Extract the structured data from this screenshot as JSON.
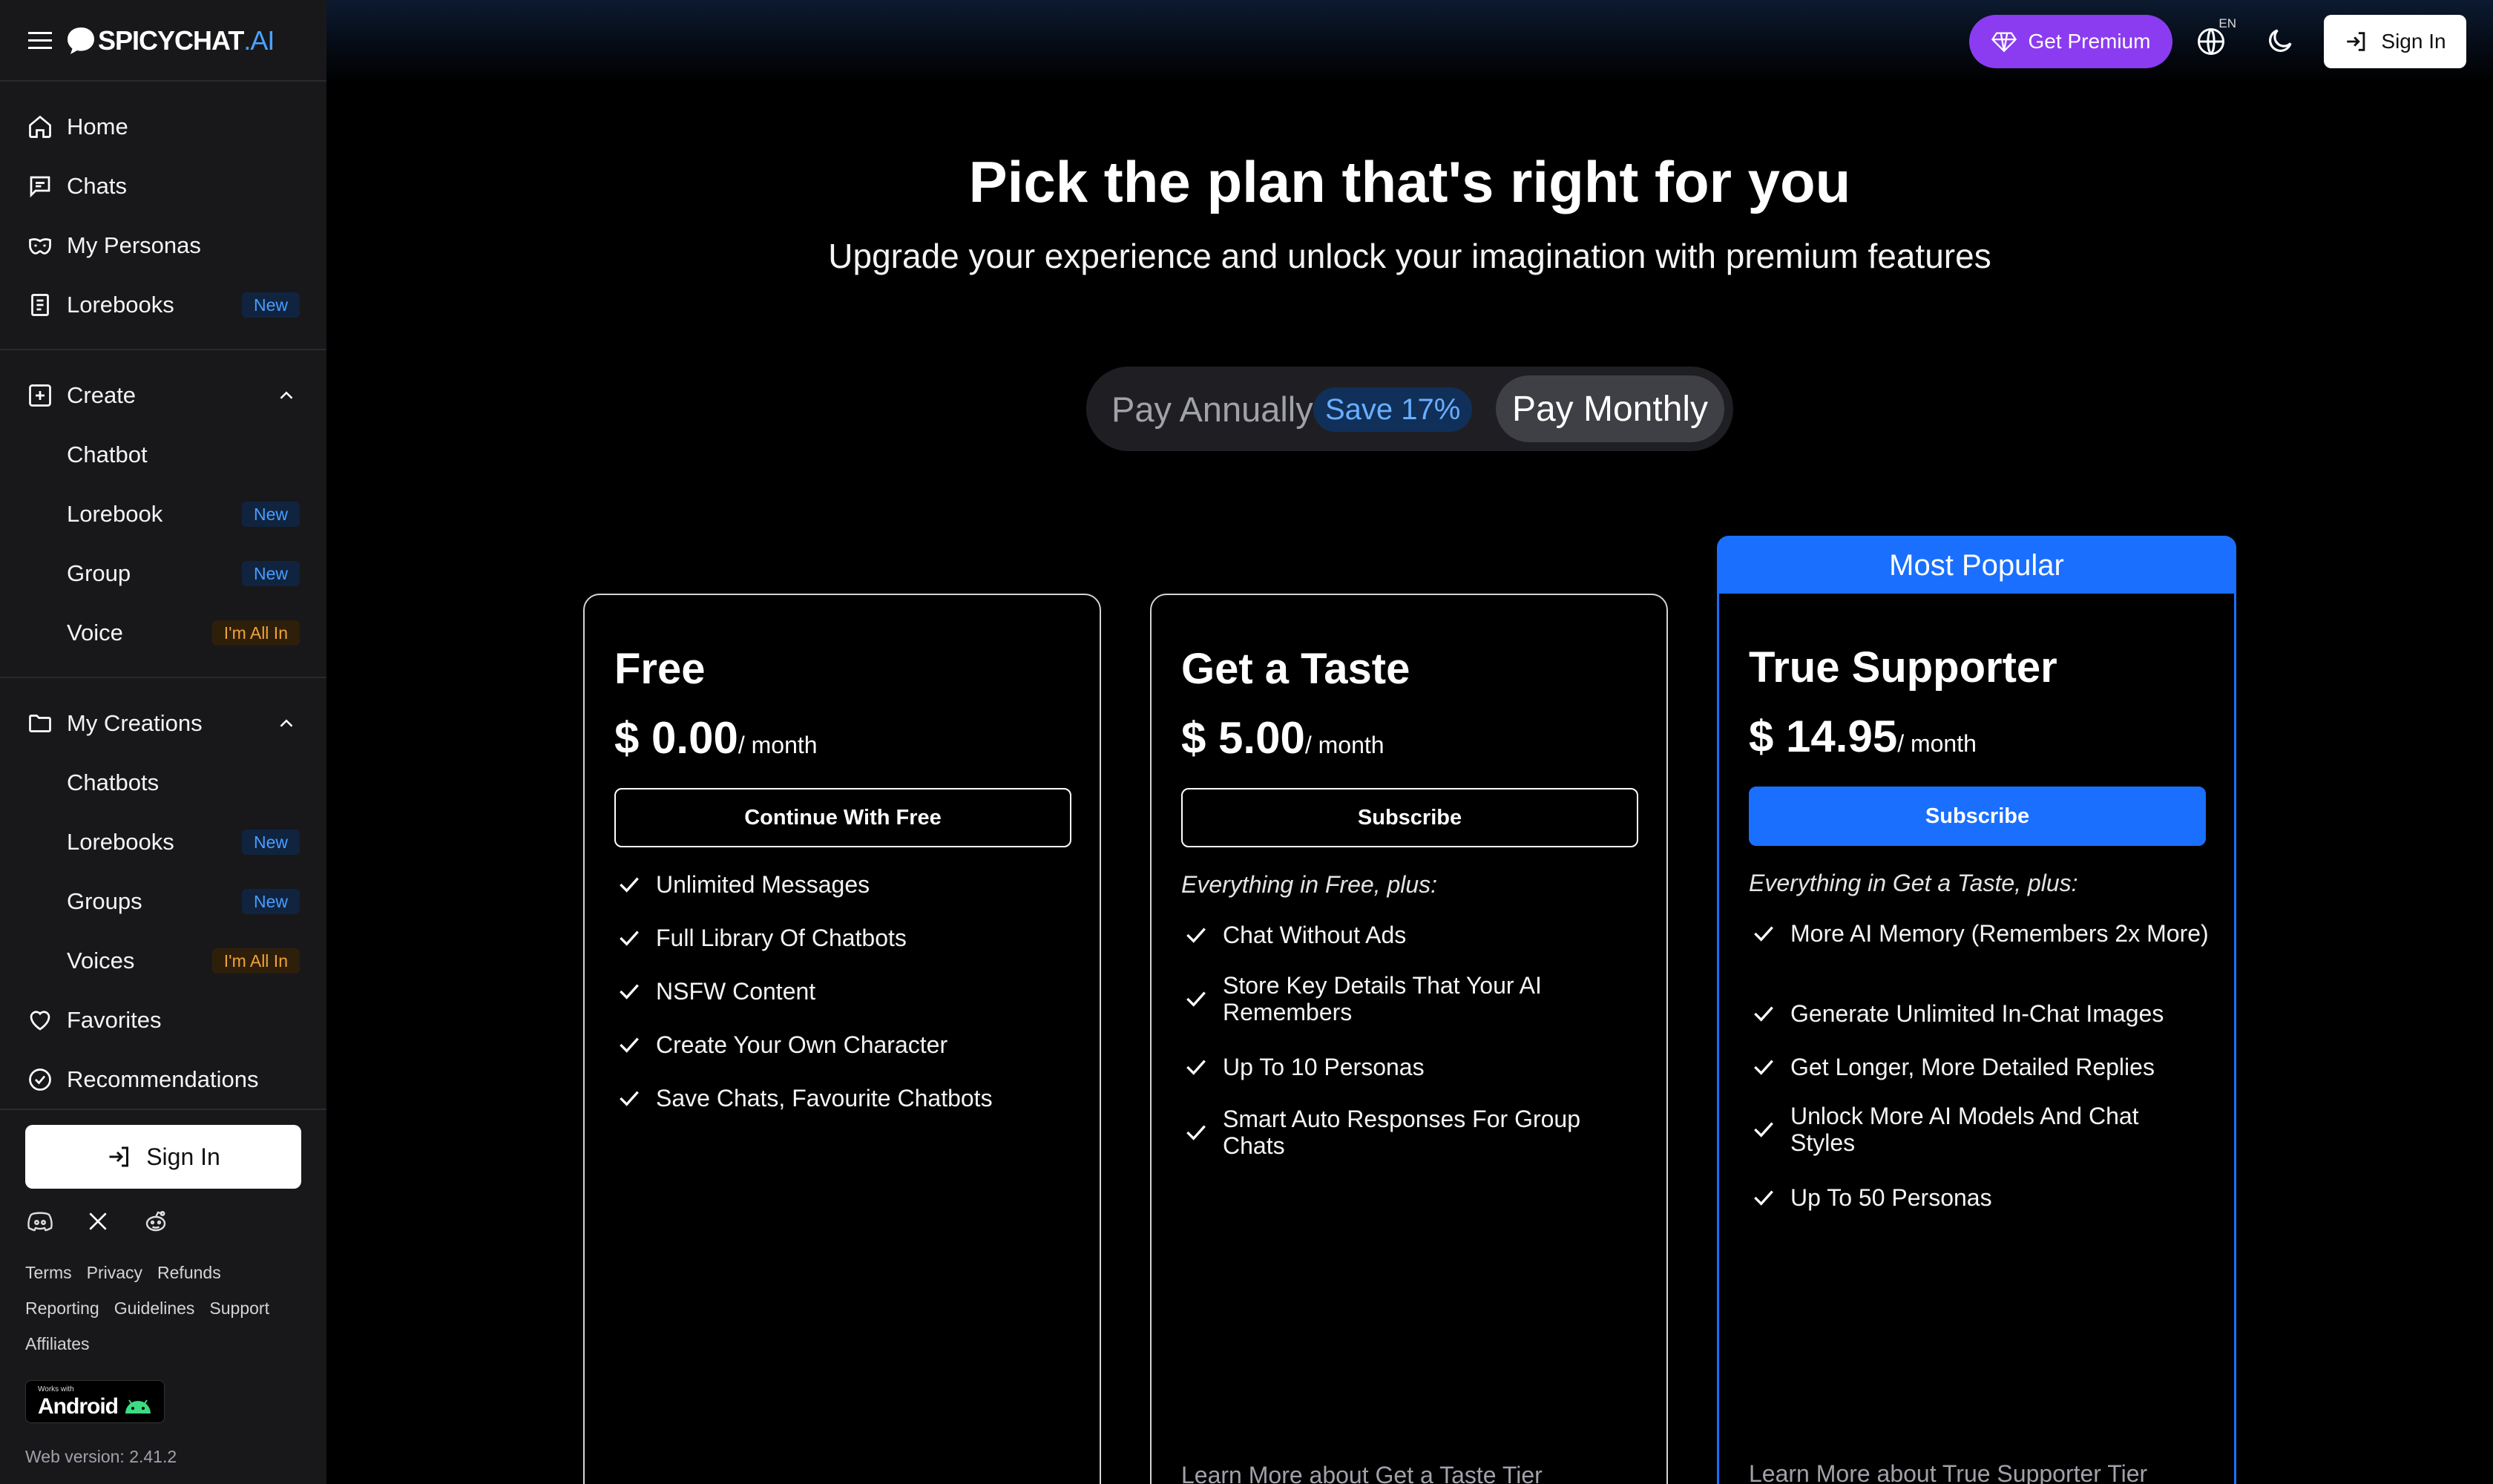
{
  "brand": {
    "name": "SPICYCHAT",
    "suffix": ".AI"
  },
  "sidebar": {
    "main": [
      {
        "label": "Home",
        "icon": "home-icon"
      },
      {
        "label": "Chats",
        "icon": "chat-icon"
      },
      {
        "label": "My Personas",
        "icon": "mask-icon"
      },
      {
        "label": "Lorebooks",
        "icon": "book-icon",
        "badge": "New"
      }
    ],
    "create": {
      "label": "Create",
      "items": [
        {
          "label": "Chatbot"
        },
        {
          "label": "Lorebook",
          "badge": "New"
        },
        {
          "label": "Group",
          "badge": "New"
        },
        {
          "label": "Voice",
          "badge": "I'm All In"
        }
      ]
    },
    "creations": {
      "label": "My Creations",
      "items": [
        {
          "label": "Chatbots"
        },
        {
          "label": "Lorebooks",
          "badge": "New"
        },
        {
          "label": "Groups",
          "badge": "New"
        },
        {
          "label": "Voices",
          "badge": "I'm All In"
        }
      ]
    },
    "favorites": "Favorites",
    "recommendations": "Recommendations",
    "sign_in": "Sign In",
    "footer_links_1": [
      "Terms",
      "Privacy",
      "Refunds"
    ],
    "footer_links_2": [
      "Reporting",
      "Guidelines",
      "Support"
    ],
    "footer_links_3": [
      "Affiliates"
    ],
    "android_small": "Works with",
    "android_big": "Android",
    "version": "Web version: 2.41.2"
  },
  "topbar": {
    "premium": "Get Premium",
    "lang": "EN",
    "sign_in": "Sign In"
  },
  "pricing": {
    "title": "Pick the plan that's right for you",
    "subtitle": "Upgrade your experience and unlock your imagination with premium features",
    "toggle": {
      "annual": "Pay Annually",
      "save": "Save 17%",
      "monthly": "Pay Monthly"
    },
    "popular_label": "Most Popular",
    "plans": [
      {
        "name": "Free",
        "price": "$ 0.00",
        "per": "/ month",
        "cta": "Continue With Free",
        "intro": "",
        "features": [
          "Unlimited Messages",
          "Full Library Of Chatbots",
          "NSFW Content",
          "Create Your Own Character",
          "Save Chats, Favourite Chatbots"
        ],
        "learn": ""
      },
      {
        "name": "Get a Taste",
        "price": "$ 5.00",
        "per": "/ month",
        "cta": "Subscribe",
        "intro": "Everything in Free, plus:",
        "features": [
          "Chat Without Ads",
          "Store Key Details That Your AI Remembers",
          "Up To 10 Personas",
          "Smart Auto Responses For Group Chats"
        ],
        "learn": "Learn More about Get a Taste Tier"
      },
      {
        "name": "True Supporter",
        "price": "$ 14.95",
        "per": "/ month",
        "cta": "Subscribe",
        "intro": "Everything in Get a Taste, plus:",
        "features": [
          "More AI Memory (Remembers 2x More)",
          "Generate Unlimited In-Chat Images",
          "Get Longer, More Detailed Replies",
          "Unlock More AI Models And Chat Styles",
          "Up To 50 Personas"
        ],
        "learn": "Learn More about True Supporter Tier"
      }
    ]
  },
  "colors": {
    "accent_blue": "#1a6fff",
    "premium_purple": "#8b3cf0",
    "sidebar_bg": "#18181b"
  }
}
